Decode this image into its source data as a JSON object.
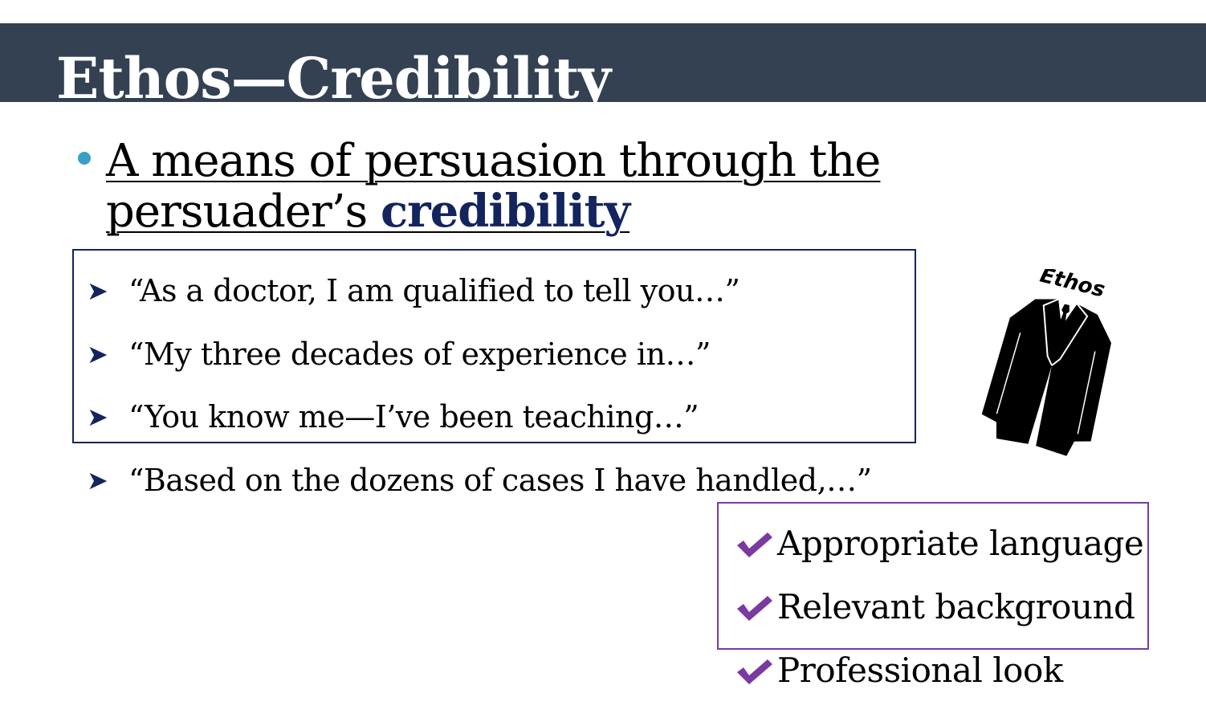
{
  "slide": {
    "title": "Ethos—Credibility",
    "main_bullet": {
      "line1": "A means of persuasion through the",
      "line2_prefix": "persuader’s ",
      "line2_emphasis": "credibility"
    },
    "quotes": [
      "“As a doctor, I am qualified to tell you…”",
      "“My three decades of experience in…”",
      "“You know me—I’ve been teaching…”",
      "“Based on the dozens of cases I have handled,…”"
    ],
    "checklist": [
      "Appropriate language",
      "Relevant background",
      "Professional look"
    ],
    "image": {
      "icon": "suit-icon",
      "label": "Ethos"
    },
    "colors": {
      "title_bar": "#334152",
      "bullet_dot": "#3a9ec9",
      "emphasis": "#13245e",
      "quote_box_border": "#13245e",
      "check": "#7a3aa0",
      "check_box_border": "#7a3aa0"
    }
  }
}
